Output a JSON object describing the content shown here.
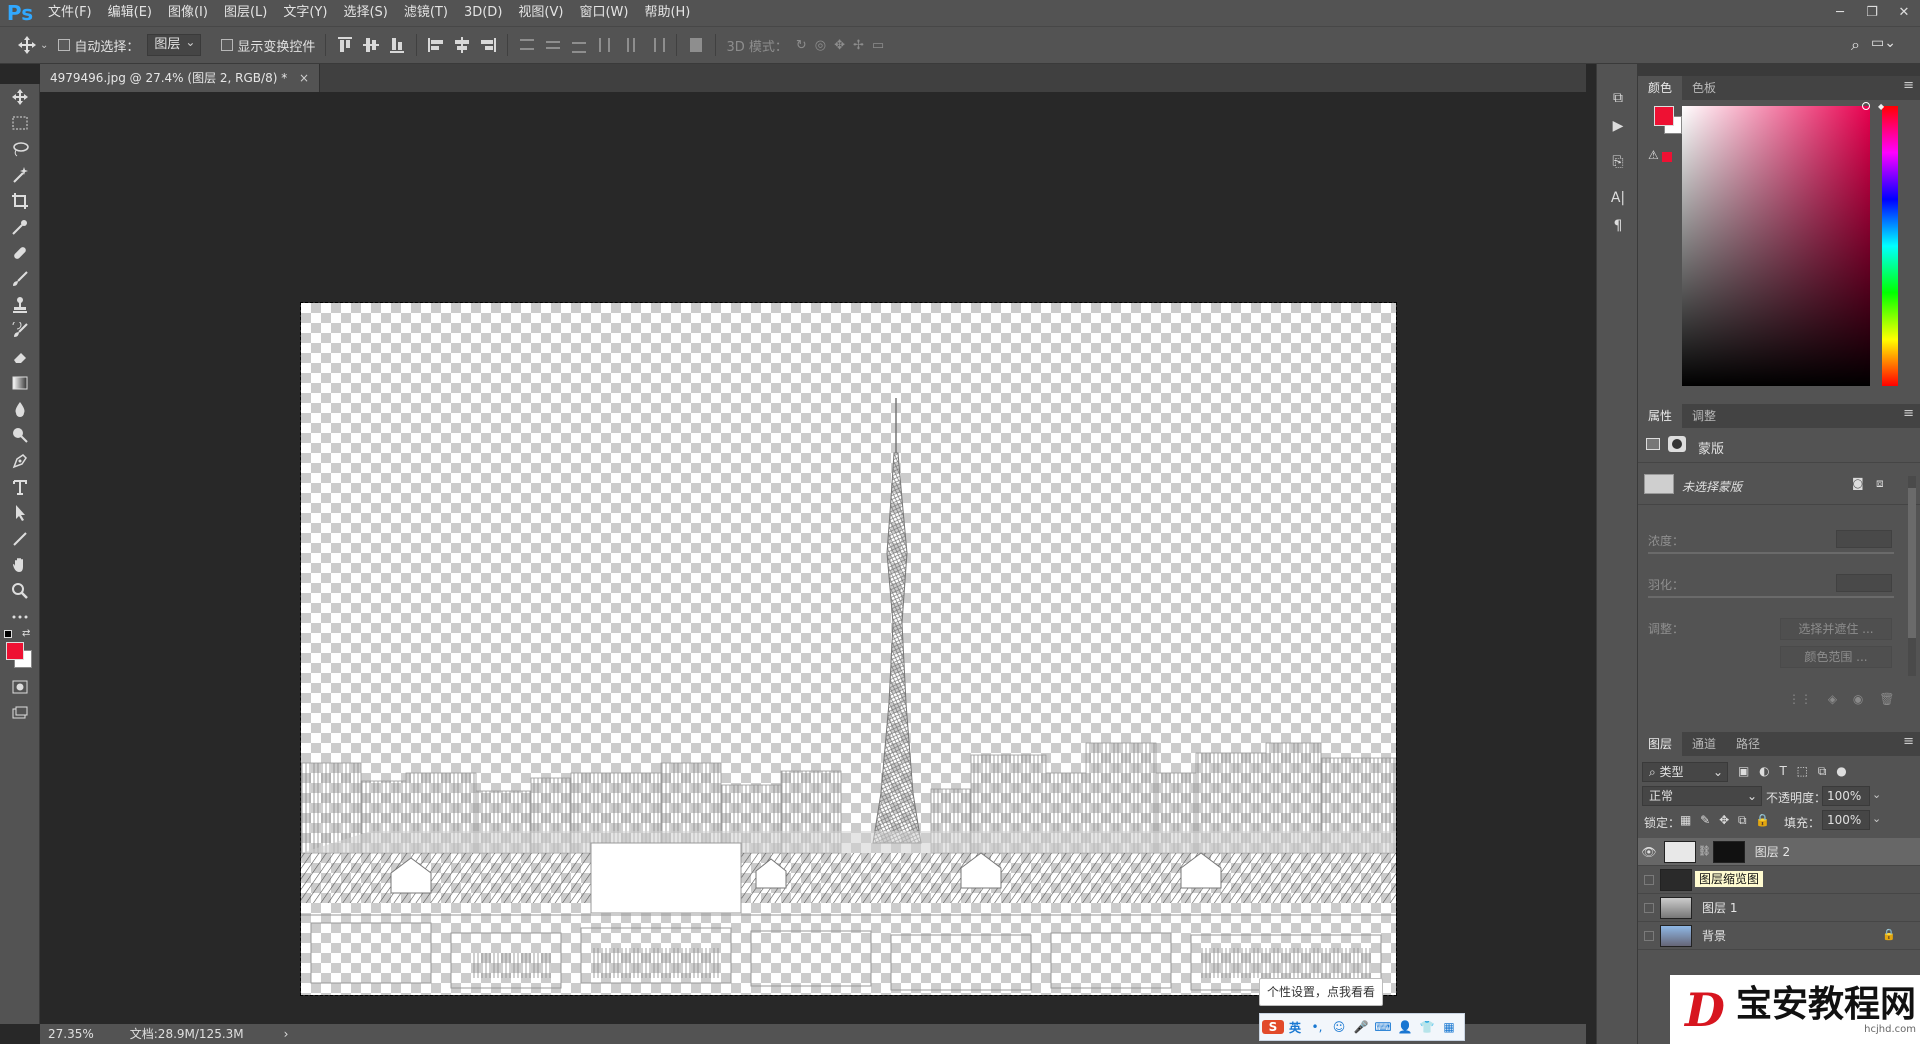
{
  "app": {
    "logo": "Ps"
  },
  "menu": [
    "文件(F)",
    "编辑(E)",
    "图像(I)",
    "图层(L)",
    "文字(Y)",
    "选择(S)",
    "滤镜(T)",
    "3D(D)",
    "视图(V)",
    "窗口(W)",
    "帮助(H)"
  ],
  "options": {
    "auto_select_label": "自动选择：",
    "auto_select_value": "图层",
    "transform_label": "显示变换控件",
    "mode_3d_label": "3D 模式："
  },
  "document": {
    "tab_title": "4979496.jpg @ 27.4% (图层 2, RGB/8) *",
    "close_glyph": "×"
  },
  "status": {
    "zoom": "27.35%",
    "doc_info": "文档:28.9M/125.3M",
    "arrow": "›"
  },
  "color_panel": {
    "tabs": [
      "颜色",
      "色板"
    ],
    "fg_color": "#ee1133",
    "bg_color": "#ffffff",
    "field_hue": "#e8004f"
  },
  "properties_panel": {
    "tabs": [
      "属性",
      "调整"
    ],
    "mask_label": "蒙版",
    "no_mask_label": "未选择蒙版",
    "density_label": "浓度：",
    "feather_label": "羽化：",
    "adjust_label": "调整：",
    "select_mask_btn": "选择并遮住 ...",
    "color_range_btn": "颜色范围 ..."
  },
  "layers_panel": {
    "tabs": [
      "图层",
      "通道",
      "路径"
    ],
    "filter_kind": "类型",
    "blend_mode": "正常",
    "opacity_label": "不透明度：",
    "opacity_value": "100%",
    "lock_label": "锁定：",
    "fill_label": "填充：",
    "fill_value": "100%",
    "layers": [
      {
        "name": "图层 2",
        "visible": true,
        "selected": true
      },
      {
        "name": "",
        "visible": false,
        "selected": false
      },
      {
        "name": "图层 1",
        "visible": false,
        "selected": false
      },
      {
        "name": "背景",
        "visible": false,
        "selected": false
      }
    ],
    "thumb_tooltip": "图层缩览图"
  },
  "ime": {
    "tip": "个性设置，点我看看",
    "lang": "英"
  },
  "watermark": {
    "logo_char": "D",
    "title": "宝安教程网",
    "url": "hcjhd.com"
  }
}
